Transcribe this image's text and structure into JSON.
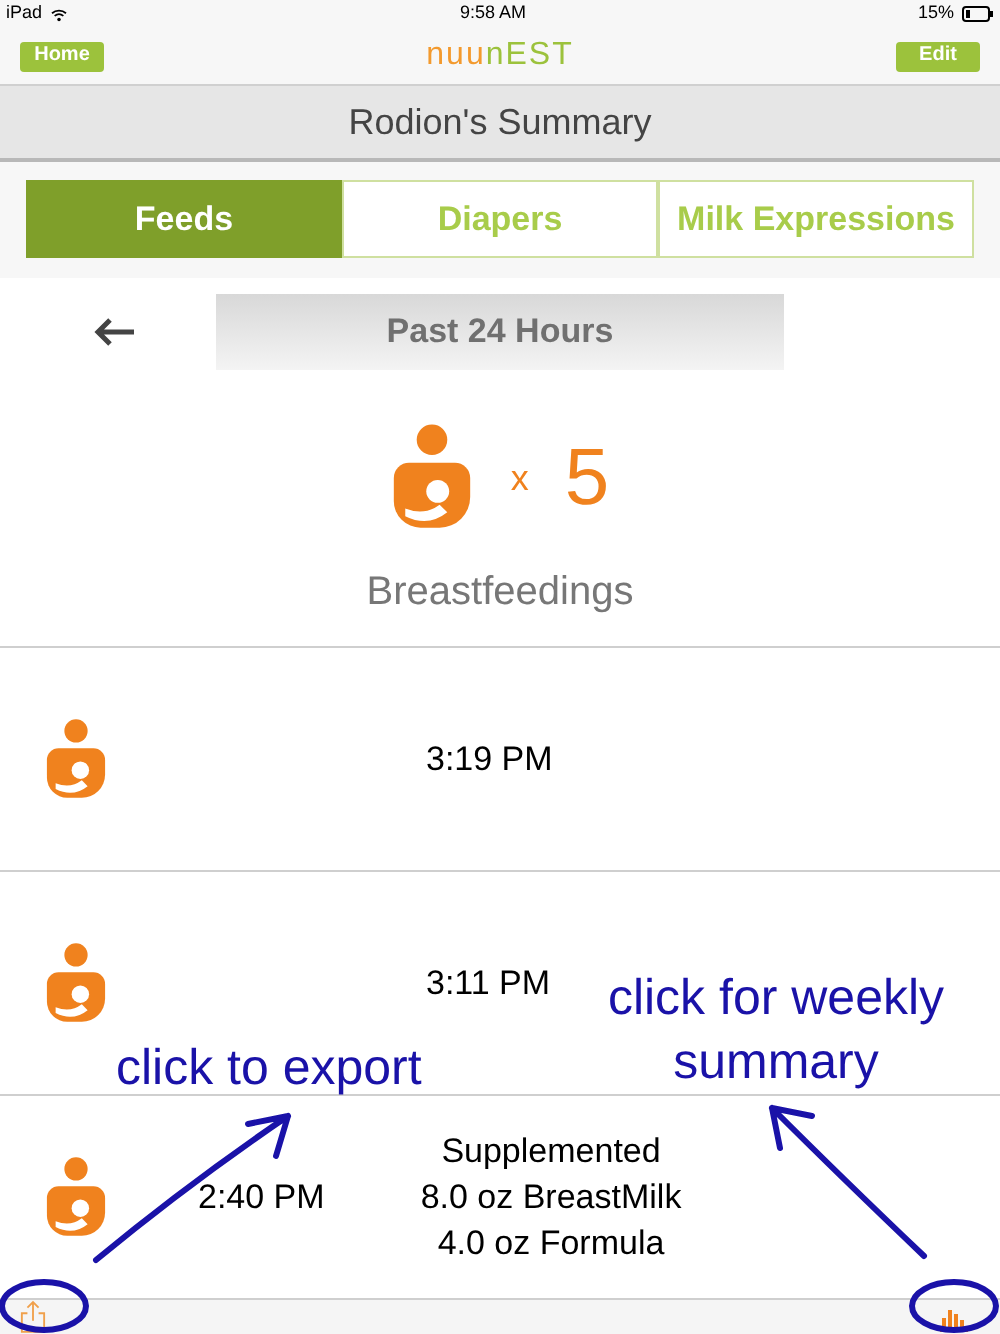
{
  "status_bar": {
    "device": "iPad",
    "time": "9:58 AM",
    "battery": "15%"
  },
  "nav": {
    "left_button": "Home",
    "logo": [
      {
        "text": "nuu",
        "color": "#f39a2e"
      },
      {
        "text": "nEST",
        "color": "#9cc23c"
      }
    ],
    "right_button": "Edit"
  },
  "title": "Rodion's Summary",
  "tabs": [
    {
      "label": "Feeds",
      "selected": true
    },
    {
      "label": "Diapers",
      "selected": false
    },
    {
      "label": "Milk Expressions",
      "selected": false
    }
  ],
  "period": "Past 24 Hours",
  "summary": {
    "multiplier": "x",
    "count": "5",
    "label": "Breastfeedings"
  },
  "feeds": [
    {
      "time": "3:19 PM"
    },
    {
      "time": "3:11 PM"
    },
    {
      "time": "2:40 PM",
      "note": [
        "Supplemented",
        "8.0 oz BreastMilk",
        "4.0 oz Formula"
      ]
    }
  ],
  "annotations": [
    {
      "text": "click to export",
      "kind": "export"
    },
    {
      "text": "click for weekly summary",
      "kind": "weekly"
    }
  ]
}
